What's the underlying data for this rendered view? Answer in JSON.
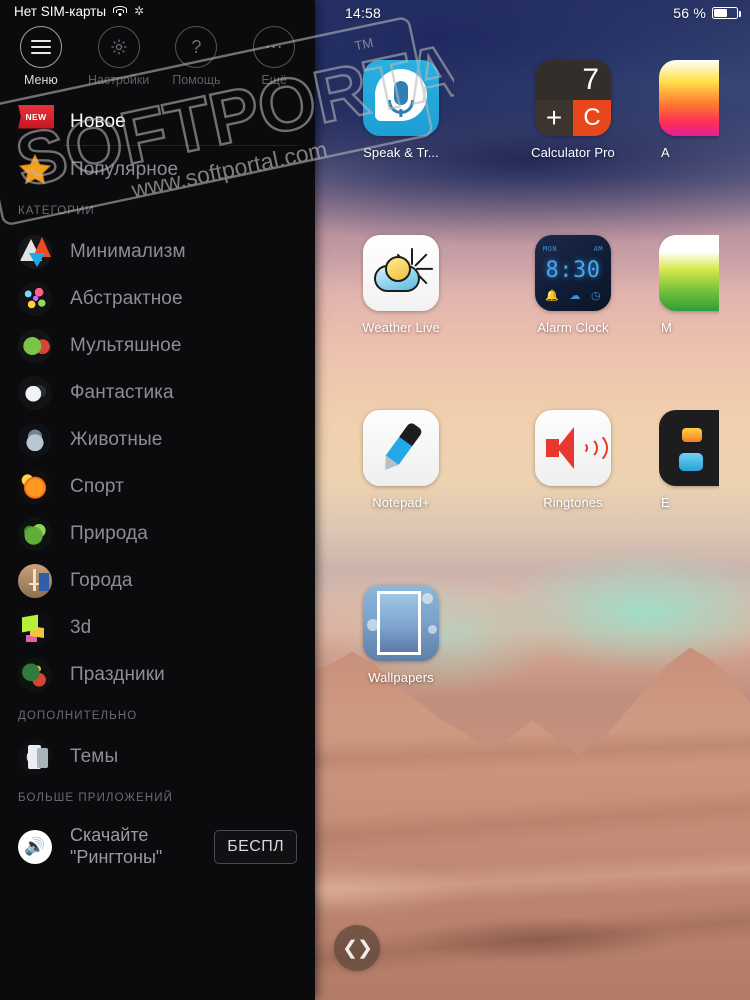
{
  "status_bar_left": {
    "carrier": "Нет SIM-карты",
    "wifi_icon": "wifi-icon",
    "sync_icon": "sync-icon"
  },
  "status_bar_right": {
    "time": "14:58",
    "battery_percent": "56 %",
    "battery_icon": "battery-icon"
  },
  "watermark": {
    "brand": "SOFTPORTAL",
    "url": "www.softportal.com",
    "tm": "TM"
  },
  "sidebar": {
    "tools": [
      {
        "label": "Меню",
        "icon": "hamburger-menu-icon",
        "active": true
      },
      {
        "label": "Настройки",
        "icon": "gear-icon",
        "active": false
      },
      {
        "label": "Помощь",
        "icon": "question-mark-icon",
        "active": false
      },
      {
        "label": "Ещё",
        "icon": "ellipsis-icon",
        "active": false
      }
    ],
    "primary_items": [
      {
        "label": "Новое",
        "icon": "new-badge-icon",
        "selected": true
      },
      {
        "label": "Популярное",
        "icon": "star-icon",
        "selected": false
      }
    ],
    "section_categories_title": "КАТЕГОРИИ",
    "categories": [
      {
        "label": "Минимализм",
        "icon": "minimalism-icon"
      },
      {
        "label": "Абстрактное",
        "icon": "abstract-icon"
      },
      {
        "label": "Мультяшное",
        "icon": "cartoon-icon"
      },
      {
        "label": "Фантастика",
        "icon": "fantasy-icon"
      },
      {
        "label": "Животные",
        "icon": "animals-icon"
      },
      {
        "label": "Спорт",
        "icon": "sport-icon"
      },
      {
        "label": "Природа",
        "icon": "nature-icon"
      },
      {
        "label": "Города",
        "icon": "cities-icon"
      },
      {
        "label": "3d",
        "icon": "3d-icon"
      },
      {
        "label": "Праздники",
        "icon": "holidays-icon"
      }
    ],
    "section_additional_title": "ДОПОЛНИТЕЛЬНО",
    "additional": [
      {
        "label": "Темы",
        "icon": "themes-icon"
      }
    ],
    "section_more_apps_title": "БОЛЬШЕ ПРИЛОЖЕНИЙ",
    "promo": {
      "line1": "Скачайте",
      "line2": "\"Рингтоны\"",
      "icon": "speaker-icon",
      "button_label": "БЕСПЛ"
    }
  },
  "home": {
    "rows": [
      [
        {
          "label": "Speak & Tr...",
          "icon": "speak-translate-icon"
        },
        {
          "label": "Calculator Pro",
          "icon": "calculator-icon",
          "calc": {
            "display": "7",
            "plus": "+",
            "clear": "C"
          }
        }
      ],
      [
        {
          "label": "Weather Live",
          "icon": "weather-icon"
        },
        {
          "label": "Alarm Clock",
          "icon": "alarm-clock-icon",
          "alarm": {
            "day": "MON",
            "meridiem": "AM",
            "time": "8:30"
          }
        }
      ],
      [
        {
          "label": "Notepad+",
          "icon": "notepad-icon"
        },
        {
          "label": "Ringtones",
          "icon": "ringtones-icon"
        }
      ],
      [
        {
          "label": "Wallpapers",
          "icon": "wallpapers-icon"
        }
      ]
    ],
    "edge_apps": [
      {
        "label": "A",
        "icon": "edge-app-1-icon"
      },
      {
        "label": "M",
        "icon": "edge-app-2-icon"
      },
      {
        "label": "E",
        "icon": "edge-app-3-icon"
      }
    ],
    "nav_fab": {
      "label": "❮❯",
      "icon": "expand-chevrons-icon"
    }
  },
  "colors": {
    "sidebar_bg": "#0b0b0d",
    "selected_text": "#ffffff",
    "muted_text": "#8d8d93",
    "accent_red": "#e8382f",
    "calc_orange": "#e8471c",
    "speak_blue": "#2ab0e0"
  }
}
